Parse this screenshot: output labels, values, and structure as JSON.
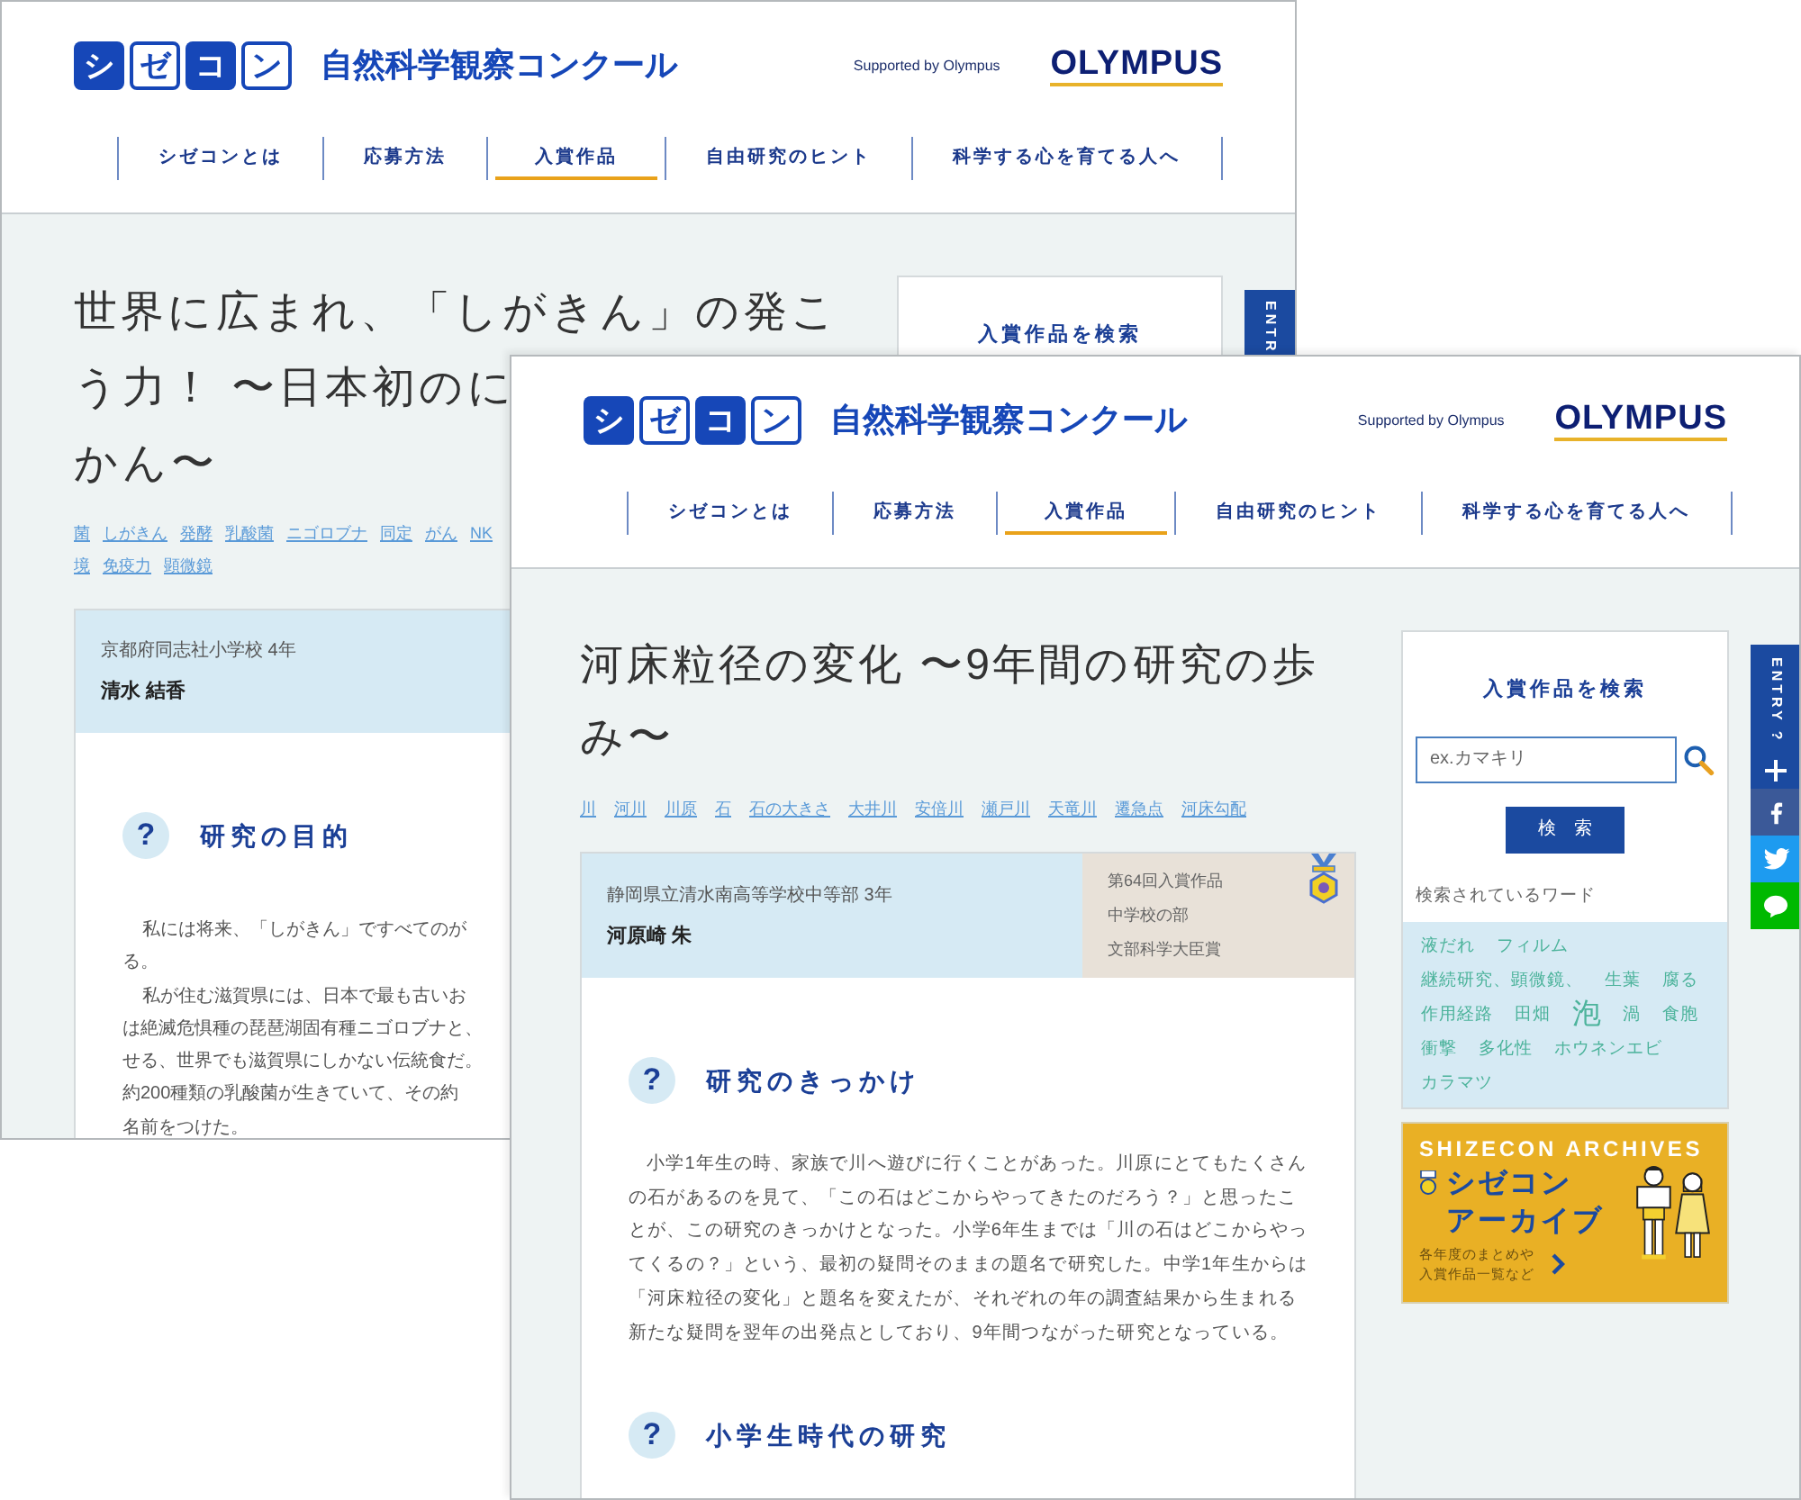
{
  "back_window": {
    "header": {
      "logo_chars": [
        {
          "char": "シ",
          "kind": "filled"
        },
        {
          "char": "ゼ",
          "kind": "outline"
        },
        {
          "char": "コ",
          "kind": "filled"
        },
        {
          "char": "ン",
          "kind": "outline"
        }
      ],
      "logo_text": "自然科学観察コンクール",
      "supported_by": "Supported by Olympus",
      "sponsor": "OLYMPUS"
    },
    "nav": [
      {
        "label": "シゼコンとは",
        "selected": false
      },
      {
        "label": "応募方法",
        "selected": false
      },
      {
        "label": "入賞作品",
        "selected": true
      },
      {
        "label": "自由研究のヒント",
        "selected": false
      },
      {
        "label": "科学する心を育てる人へ",
        "selected": false
      }
    ],
    "title_lines": [
      "世界に広まれ、「しがきん」の発こ",
      "う力！ 〜日本初のに",
      "かん〜"
    ],
    "tag_lines": [
      [
        "菌",
        "しがきん",
        "発酵",
        "乳酸菌",
        "ニゴロブナ",
        "同定",
        "がん",
        "NK"
      ],
      [
        "境",
        "免疫力",
        "顕微鏡"
      ]
    ],
    "search_title": "入賞作品を検索",
    "entry_tab": "ENTR",
    "card": {
      "school": "京都府同志社小学校 4年",
      "name": "清水 結香",
      "heading_icon": "?",
      "heading": "研究の目的",
      "paragraph_lines": [
        {
          "text": "私には将来、「しがきん」ですべてのが",
          "indent": true
        },
        {
          "text": "る。",
          "indent": false
        },
        {
          "text": "私が住む滋賀県には、日本で最も古いお",
          "indent": true
        },
        {
          "text": "は絶滅危惧種の琵琶湖固有種ニゴロブナと、",
          "indent": false
        },
        {
          "text": "せる、世界でも滋賀県にしかない伝統食だ。",
          "indent": false
        },
        {
          "text": "約200種類の乳酸菌が生きていて、その約",
          "indent": false
        },
        {
          "text": "名前をつけた。",
          "indent": false
        }
      ]
    }
  },
  "front_window": {
    "header": {
      "logo_chars": [
        {
          "char": "シ",
          "kind": "filled"
        },
        {
          "char": "ゼ",
          "kind": "outline"
        },
        {
          "char": "コ",
          "kind": "filled"
        },
        {
          "char": "ン",
          "kind": "outline"
        }
      ],
      "logo_text": "自然科学観察コンクール",
      "supported_by": "Supported by Olympus",
      "sponsor": "OLYMPUS"
    },
    "nav": [
      {
        "label": "シゼコンとは",
        "selected": false
      },
      {
        "label": "応募方法",
        "selected": false
      },
      {
        "label": "入賞作品",
        "selected": true
      },
      {
        "label": "自由研究のヒント",
        "selected": false
      },
      {
        "label": "科学する心を育てる人へ",
        "selected": false
      }
    ],
    "title": "河床粒径の変化 〜9年間の研究の歩み〜",
    "tags": [
      "川",
      "河川",
      "川原",
      "石",
      "石の大きさ",
      "大井川",
      "安倍川",
      "瀬戸川",
      "天竜川",
      "遷急点",
      "河床勾配"
    ],
    "card": {
      "school": "静岡県立清水南高等学校中等部 3年",
      "name": "河原崎 朱",
      "award_lines": [
        "第64回入賞作品",
        "中学校の部",
        "文部科学大臣賞"
      ],
      "heading_icon": "?",
      "heading": "研究のきっかけ",
      "paragraph": "小学1年生の時、家族で川へ遊びに行くことがあった。川原にとてもたくさんの石があるのを見て、「この石はどこからやってきたのだろう？」と思ったことが、この研究のきっかけとなった。小学6年生までは「川の石はどこからやってくるの？」という、最初の疑問そのままの題名で研究した。中学1年生からは「河床粒径の変化」と題名を変えたが、それぞれの年の調査結果から生まれる新たな疑問を翌年の出発点としており、9年間つながった研究となっている。",
      "next_heading_icon": "?",
      "next_heading": "小学生時代の研究"
    },
    "search": {
      "title": "入賞作品を検索",
      "placeholder": "ex.カマキリ",
      "button": "検　索",
      "popular_label": "検索されているワード",
      "words": [
        {
          "text": "液だれ",
          "emphasized": false
        },
        {
          "text": "フィルム",
          "emphasized": false
        },
        {
          "text": "継続研究、顕微鏡、",
          "emphasized": false
        },
        {
          "text": "生葉",
          "emphasized": false
        },
        {
          "text": "腐る",
          "emphasized": false
        },
        {
          "text": "作用経路",
          "emphasized": false
        },
        {
          "text": "田畑",
          "emphasized": false
        },
        {
          "text": "泡",
          "emphasized": true
        },
        {
          "text": "渦",
          "emphasized": false
        },
        {
          "text": "食胞",
          "emphasized": false
        },
        {
          "text": "衝撃",
          "emphasized": false
        },
        {
          "text": "多化性",
          "emphasized": false
        },
        {
          "text": "ホウネンエビ",
          "emphasized": false
        },
        {
          "text": "カラマツ",
          "emphasized": false
        }
      ]
    },
    "archive": {
      "title": "SHIZECON ARCHIVES",
      "name_lines": [
        "シゼコン",
        "アーカイブ"
      ],
      "caption_lines": [
        "各年度のまとめや",
        "入賞作品一覧など"
      ]
    },
    "side_tab": {
      "entry_label": "ENTRY ?"
    }
  }
}
